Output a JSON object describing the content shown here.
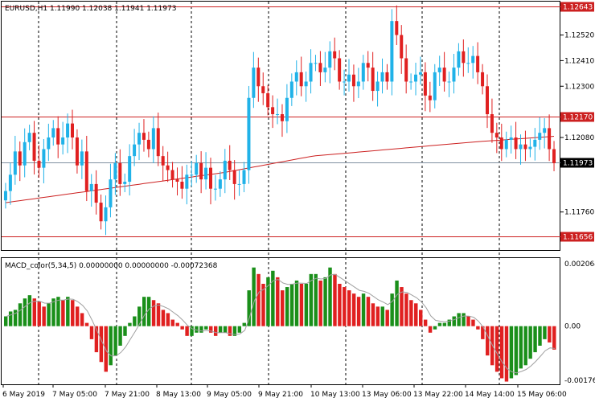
{
  "main_panel": {
    "symbol_info": "EURUSD,H1  1.11990 1.12038 1.11941 1.11973",
    "price_axis_labels": [
      "1.12643",
      "1.12520",
      "1.12410",
      "1.12300",
      "1.12080",
      "1.11970",
      "1.11760",
      "1.11656"
    ],
    "marked_levels": [
      {
        "label": "1.12643",
        "value": 1.12643
      },
      {
        "label": "1.12170",
        "value": 1.1217
      },
      {
        "label": "1.11656",
        "value": 1.11656
      }
    ],
    "current_price": {
      "label": "1.11973",
      "value": 1.11973
    }
  },
  "macd_panel": {
    "indicator_label": "MACD_color(5,34,5) 0.00000000 0.00000000 -0.00072368",
    "axis_labels": [
      "0.0020647",
      "0.00",
      "-0.0017603"
    ]
  },
  "time_axis_labels": [
    "6 May 2019",
    "7 May 05:00",
    "7 May 21:00",
    "8 May 13:00",
    "9 May 05:00",
    "9 May 21:00",
    "10 May 13:00",
    "13 May 06:00",
    "13 May 22:00",
    "14 May 14:00",
    "15 May 06:00"
  ],
  "colors": {
    "bull": "#20b2e8",
    "bear": "#e02020",
    "ma_line": "#cc2020",
    "level_line": "#cc2020",
    "macd_up": "#1a8f1a",
    "macd_down": "#e02020",
    "signal_line": "#a0a0a0",
    "grid": "#000000"
  },
  "chart_data": [
    {
      "type": "candlestick",
      "title": "EURUSD,H1",
      "ylim": [
        1.116,
        1.1266
      ],
      "close_series": [
        1.1185,
        1.1192,
        1.1202,
        1.1196,
        1.1206,
        1.121,
        1.1198,
        1.1195,
        1.1203,
        1.1208,
        1.1212,
        1.1205,
        1.1208,
        1.1214,
        1.1208,
        1.1196,
        1.1202,
        1.1185,
        1.1188,
        1.118,
        1.1172,
        1.1178,
        1.119,
        1.1197,
        1.1188,
        1.1189,
        1.12,
        1.1205,
        1.121,
        1.1207,
        1.1203,
        1.1212,
        1.12,
        1.1196,
        1.1194,
        1.119,
        1.1189,
        1.1186,
        1.1192,
        1.1192,
        1.1197,
        1.119,
        1.1195,
        1.1186,
        1.1186,
        1.119,
        1.1198,
        1.1194,
        1.1188,
        1.1188,
        1.1194,
        1.1225,
        1.1238,
        1.123,
        1.1227,
        1.1221,
        1.1218,
        1.1218,
        1.1215,
        1.1225,
        1.1232,
        1.1236,
        1.123,
        1.1232,
        1.124,
        1.124,
        1.1236,
        1.1238,
        1.1245,
        1.1242,
        1.1232,
        1.1232,
        1.1235,
        1.123,
        1.1232,
        1.124,
        1.1238,
        1.1228,
        1.1232,
        1.1236,
        1.1232,
        1.1258,
        1.1252,
        1.1242,
        1.1232,
        1.1232,
        1.1235,
        1.1236,
        1.1226,
        1.1224,
        1.1236,
        1.1238,
        1.1232,
        1.1232,
        1.1238,
        1.1245,
        1.124,
        1.124,
        1.1243,
        1.1236,
        1.123,
        1.1218,
        1.121,
        1.1208,
        1.1203,
        1.1207,
        1.1208,
        1.1203,
        1.1205,
        1.1203,
        1.1204,
        1.1207,
        1.121,
        1.1212,
        1.1203,
        1.1197
      ],
      "ma_range": [
        1.118,
        1.1206
      ],
      "levels": [
        1.12643,
        1.1217,
        1.11656
      ],
      "grid": true
    },
    {
      "type": "bar",
      "title": "MACD_color(5,34,5)",
      "ylim": [
        -0.0017603,
        0.0020647
      ],
      "histogram": [
        0.0003,
        0.00045,
        0.0005,
        0.0007,
        0.00085,
        0.00095,
        0.00085,
        0.00075,
        0.0006,
        0.0007,
        0.00085,
        0.0009,
        0.0008,
        0.0009,
        0.0008,
        0.0006,
        0.0004,
        0.0001,
        -0.0004,
        -0.0008,
        -0.0011,
        -0.0014,
        -0.0012,
        -0.0009,
        -0.0006,
        -0.0003,
        0.0001,
        0.0003,
        0.0006,
        0.0009,
        0.0009,
        0.0008,
        0.0007,
        0.0005,
        0.0004,
        0.0002,
        0.0001,
        -0.0001,
        -0.0003,
        -0.0003,
        -0.0002,
        -0.0002,
        -0.0001,
        -0.0002,
        -0.0003,
        -0.0002,
        -0.0002,
        -0.0003,
        -0.0003,
        -0.0002,
        0.0001,
        0.0011,
        0.0018,
        0.0016,
        0.0013,
        0.0015,
        0.0017,
        0.0015,
        0.0011,
        0.0012,
        0.0013,
        0.0014,
        0.0013,
        0.0013,
        0.0016,
        0.0016,
        0.0014,
        0.0015,
        0.0018,
        0.0016,
        0.0013,
        0.0012,
        0.0011,
        0.001,
        0.0009,
        0.001,
        0.0009,
        0.0007,
        0.0006,
        0.0006,
        0.0005,
        0.001,
        0.0014,
        0.0012,
        0.001,
        0.0008,
        0.0007,
        0.0005,
        0.0002,
        -0.0002,
        -0.0001,
        0.0001,
        0.0001,
        0.0002,
        0.0003,
        0.0004,
        0.0004,
        0.0003,
        0.0002,
        -0.0001,
        -0.0004,
        -0.0009,
        -0.0012,
        -0.0014,
        -0.0016,
        -0.0017,
        -0.0016,
        -0.0015,
        -0.0013,
        -0.0012,
        -0.001,
        -0.0008,
        -0.0006,
        -0.0004,
        -0.0005,
        -0.00072
      ],
      "zero_line": 0.0,
      "grid": true
    }
  ]
}
